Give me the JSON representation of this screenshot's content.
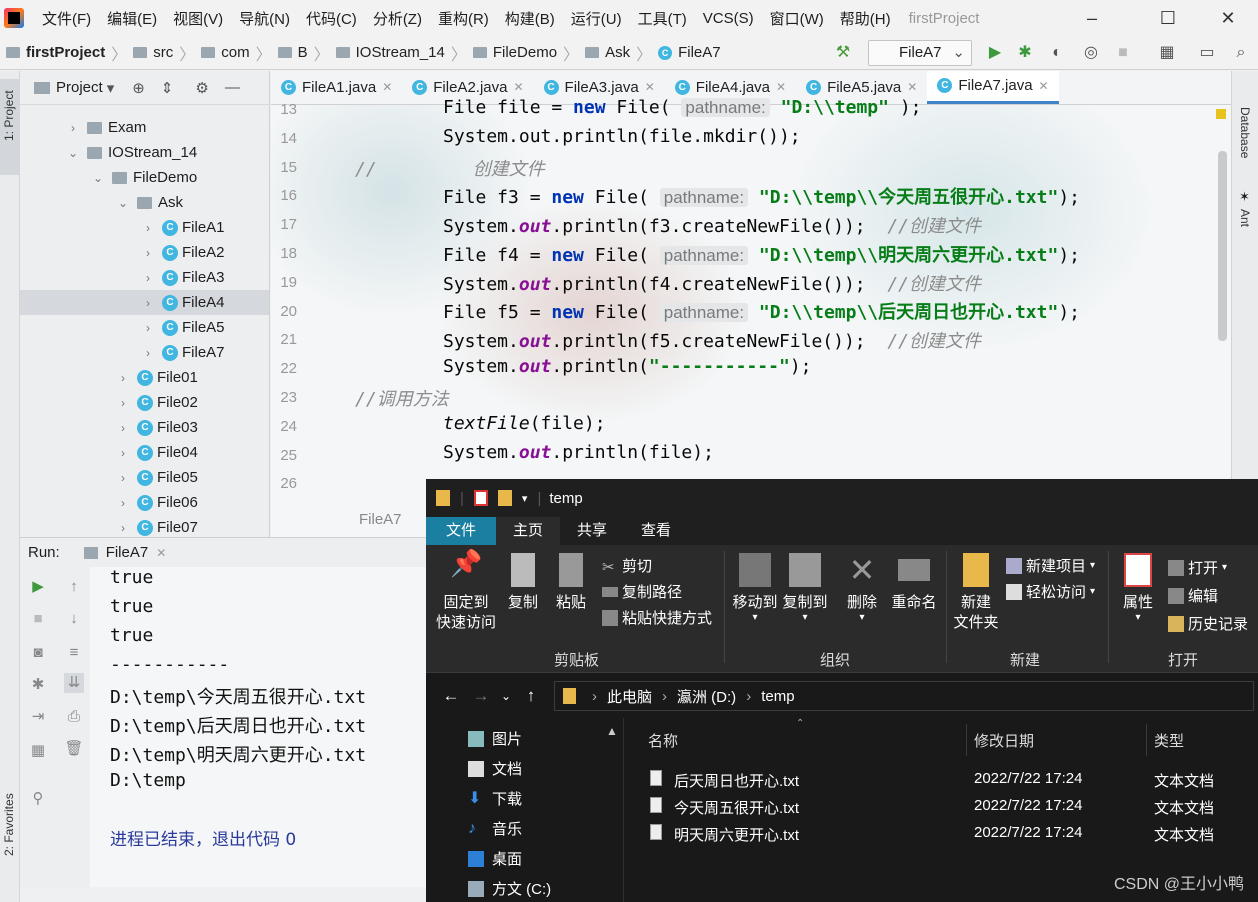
{
  "menubar": {
    "items": [
      "文件(F)",
      "编辑(E)",
      "视图(V)",
      "导航(N)",
      "代码(C)",
      "分析(Z)",
      "重构(R)",
      "构建(B)",
      "运行(U)",
      "工具(T)",
      "VCS(S)",
      "窗口(W)",
      "帮助(H)"
    ],
    "title": "firstProject"
  },
  "breadcrumb": [
    "firstProject",
    "src",
    "com",
    "B",
    "IOStream_14",
    "FileDemo",
    "Ask",
    "FileA7"
  ],
  "run_config": "FileA7",
  "side_labels": {
    "project": "1: Project",
    "favorites": "2: Favorites",
    "database": "Database",
    "ant": "Ant"
  },
  "project_panel": {
    "title": "Project",
    "tree": [
      {
        "label": "Exam",
        "type": "folder",
        "depth": 2,
        "expanded": false
      },
      {
        "label": "IOStream_14",
        "type": "folder",
        "depth": 2,
        "expanded": true
      },
      {
        "label": "FileDemo",
        "type": "folder",
        "depth": 3,
        "expanded": true
      },
      {
        "label": "Ask",
        "type": "folder",
        "depth": 4,
        "expanded": true
      },
      {
        "label": "FileA1",
        "type": "class",
        "depth": 5
      },
      {
        "label": "FileA2",
        "type": "class",
        "depth": 5
      },
      {
        "label": "FileA3",
        "type": "class",
        "depth": 5
      },
      {
        "label": "FileA4",
        "type": "class",
        "depth": 5,
        "selected": true
      },
      {
        "label": "FileA5",
        "type": "class",
        "depth": 5
      },
      {
        "label": "FileA7",
        "type": "class",
        "depth": 5
      },
      {
        "label": "File01",
        "type": "class",
        "depth": 4
      },
      {
        "label": "File02",
        "type": "class",
        "depth": 4
      },
      {
        "label": "File03",
        "type": "class",
        "depth": 4
      },
      {
        "label": "File04",
        "type": "class",
        "depth": 4
      },
      {
        "label": "File05",
        "type": "class",
        "depth": 4
      },
      {
        "label": "File06",
        "type": "class",
        "depth": 4
      },
      {
        "label": "File07",
        "type": "class",
        "depth": 4
      }
    ]
  },
  "editor": {
    "tabs": [
      {
        "label": "FileA1.java",
        "active": false
      },
      {
        "label": "FileA2.java",
        "active": false
      },
      {
        "label": "FileA3.java",
        "active": false
      },
      {
        "label": "FileA4.java",
        "active": false
      },
      {
        "label": "FileA5.java",
        "active": false
      },
      {
        "label": "FileA7.java",
        "active": true
      }
    ],
    "line_numbers": [
      "13",
      "14",
      "15",
      "16",
      "17",
      "18",
      "19",
      "20",
      "21",
      "22",
      "23",
      "24",
      "25",
      "26"
    ],
    "breadcrumb_bottom": "FileA7",
    "code": {
      "l13": {
        "decl": "File file = ",
        "kw": "new",
        "call": " File( ",
        "hint": "pathname:",
        "str": " \"D:\\\\temp\"",
        "end": " );"
      },
      "l14": {
        "text": "System.out.println(file.mkdir());"
      },
      "l15": {
        "comment_prefix": "//",
        "comment": "创建文件"
      },
      "f3": {
        "decl": "File f3 = ",
        "kw": "new",
        "call": " File( ",
        "hint": "pathname:",
        "str": " \"D:\\\\temp\\\\今天周五很开心.txt\"",
        "end": ");"
      },
      "f3p": {
        "pre": "System.",
        "fld": "out",
        "mid": ".println(f3.createNewFile());",
        "cmt": "  //创建文件"
      },
      "f4": {
        "decl": "File f4 = ",
        "kw": "new",
        "call": " File( ",
        "hint": "pathname:",
        "str": " \"D:\\\\temp\\\\明天周六更开心.txt\"",
        "end": ");"
      },
      "f4p": {
        "pre": "System.",
        "fld": "out",
        "mid": ".println(f4.createNewFile());",
        "cmt": "  //创建文件"
      },
      "f5": {
        "decl": "File f5 = ",
        "kw": "new",
        "call": " File( ",
        "hint": "pathname:",
        "str": " \"D:\\\\temp\\\\后天周日也开心.txt\"",
        "end": ");"
      },
      "f5p": {
        "pre": "System.",
        "fld": "out",
        "mid": ".println(f5.createNewFile());",
        "cmt": "  //创建文件"
      },
      "dash": {
        "pre": "System.",
        "fld": "out",
        "mid": ".println(",
        "str": "\"-----------\"",
        "end": ");"
      },
      "call_comment": "//调用方法",
      "textfile": {
        "method": "textFile",
        "rest": "(file);"
      },
      "last": {
        "pre": "System.",
        "fld": "out",
        "mid": ".println(file);"
      }
    }
  },
  "run_panel": {
    "label": "Run:",
    "tab": "FileA7",
    "output": [
      "true",
      "true",
      "true",
      "-----------",
      "D:\\temp\\今天周五很开心.txt",
      "D:\\temp\\后天周日也开心.txt",
      "D:\\temp\\明天周六更开心.txt",
      "D:\\temp"
    ],
    "exit": "进程已结束，退出代码 0"
  },
  "explorer": {
    "title": "temp",
    "tabs": [
      "文件",
      "主页",
      "共享",
      "查看"
    ],
    "ribbon": {
      "pin": [
        "固定到",
        "快速访问"
      ],
      "copy": "复制",
      "paste": "粘贴",
      "cut": "剪切",
      "copy_path": "复制路径",
      "paste_shortcut": "粘贴快捷方式",
      "move_to": "移动到",
      "copy_to": "复制到",
      "delete": "删除",
      "rename": "重命名",
      "new_folder": [
        "新建",
        "文件夹"
      ],
      "new_item": "新建项目",
      "easy_access": "轻松访问",
      "properties": "属性",
      "open": "打开",
      "edit": "编辑",
      "history": "历史记录",
      "groups": [
        "剪贴板",
        "组织",
        "新建",
        "打开"
      ]
    },
    "address": [
      "此电脑",
      "瀛洲 (D:)",
      "temp"
    ],
    "nav": [
      "图片",
      "文档",
      "下载",
      "音乐",
      "桌面",
      "方文 (C:)"
    ],
    "columns": [
      "名称",
      "修改日期",
      "类型"
    ],
    "files": [
      {
        "name": "后天周日也开心.txt",
        "date": "2022/7/22 17:24",
        "type": "文本文档"
      },
      {
        "name": "今天周五很开心.txt",
        "date": "2022/7/22 17:24",
        "type": "文本文档"
      },
      {
        "name": "明天周六更开心.txt",
        "date": "2022/7/22 17:24",
        "type": "文本文档"
      }
    ]
  },
  "watermark": "CSDN @王小小鸭",
  "colors": {
    "keyword": "#0033b3",
    "string": "#067d17",
    "field": "#871094",
    "accent": "#4083c9",
    "explorer_file_tab": "#1a7fa0"
  }
}
